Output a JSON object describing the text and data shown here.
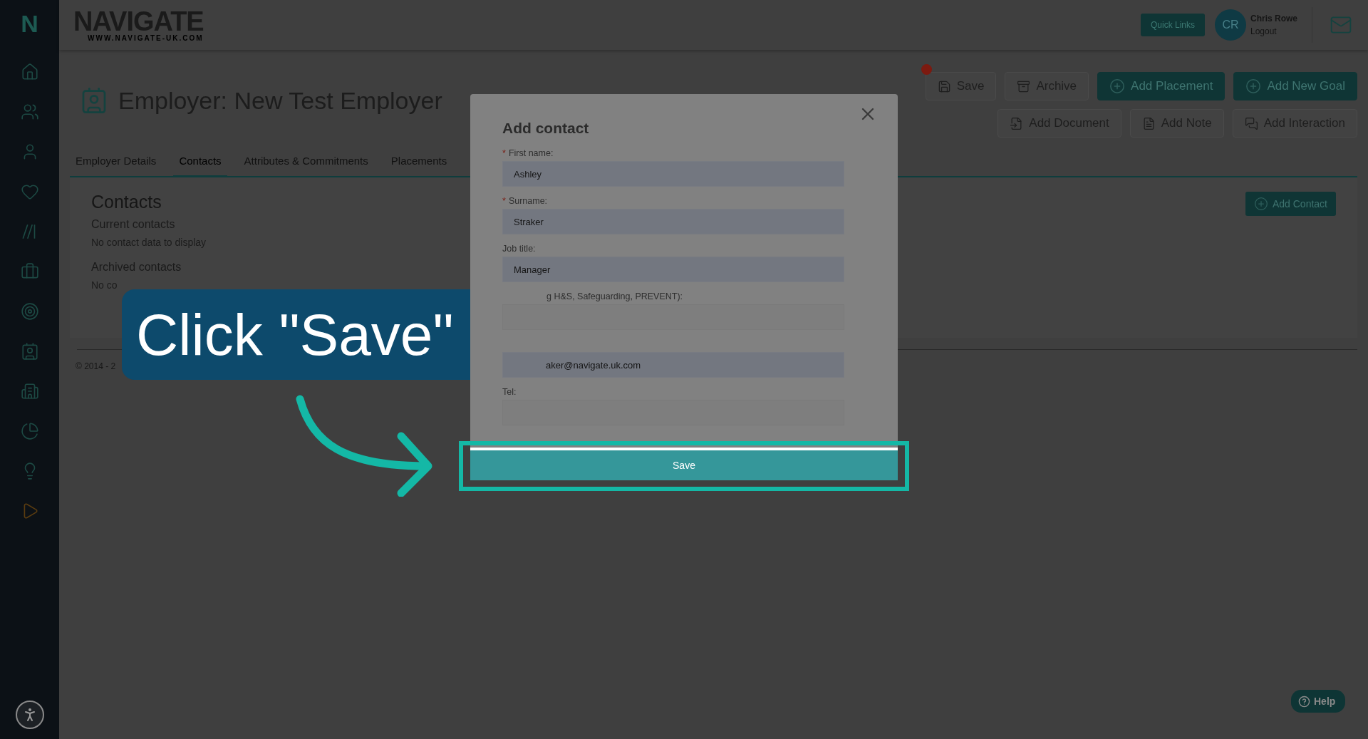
{
  "sidebar": {
    "logo": "N"
  },
  "header": {
    "logo": "NAVIGATE",
    "logo_sub": "WWW.NAVIGATE-UK.COM",
    "quick_links": "Quick Links",
    "user": {
      "initials": "CR",
      "name": "Chris Rowe",
      "logout": "Logout"
    }
  },
  "page": {
    "title": "Employer: New Test Employer",
    "actions": [
      {
        "label": "Save",
        "kind": "outline",
        "unsaved": true
      },
      {
        "label": "Archive",
        "kind": "outline",
        "unsaved": false
      },
      {
        "label": "Add Placement",
        "kind": "filled",
        "unsaved": false
      },
      {
        "label": "Add New Goal",
        "kind": "filled",
        "unsaved": false
      },
      {
        "label": "Add Document",
        "kind": "outline",
        "unsaved": false
      },
      {
        "label": "Add Note",
        "kind": "outline",
        "unsaved": false
      },
      {
        "label": "Add Interaction",
        "kind": "outline",
        "unsaved": false
      }
    ],
    "tabs": [
      {
        "label": "Employer Details",
        "selected": false
      },
      {
        "label": "Contacts",
        "selected": true
      },
      {
        "label": "Attributes & Commitments",
        "selected": false
      },
      {
        "label": "Placements",
        "selected": false
      }
    ],
    "section": {
      "heading": "Contacts",
      "add_button": "Add Contact",
      "groups": [
        {
          "title": "Current contacts",
          "empty": "No contact data to display"
        },
        {
          "title": "Archived contacts",
          "empty": "No co"
        }
      ]
    },
    "footer": "© 2014 - 2"
  },
  "dialog": {
    "title": "Add contact",
    "required_mark": "*",
    "fields": [
      {
        "label": "First name:",
        "required": true,
        "value": "Ashley"
      },
      {
        "label": "Surname:",
        "required": true,
        "value": "Straker"
      },
      {
        "label": "Job title:",
        "required": false,
        "value": "Manager"
      },
      {
        "label": "g H&S, Safeguarding, PREVENT):",
        "required": false
      },
      {
        "value": "aker@navigate.uk.com"
      },
      {
        "label": "Tel:",
        "required": false
      }
    ],
    "save": "Save"
  },
  "callout": {
    "text": "Click \"Save\""
  },
  "help": "Help"
}
